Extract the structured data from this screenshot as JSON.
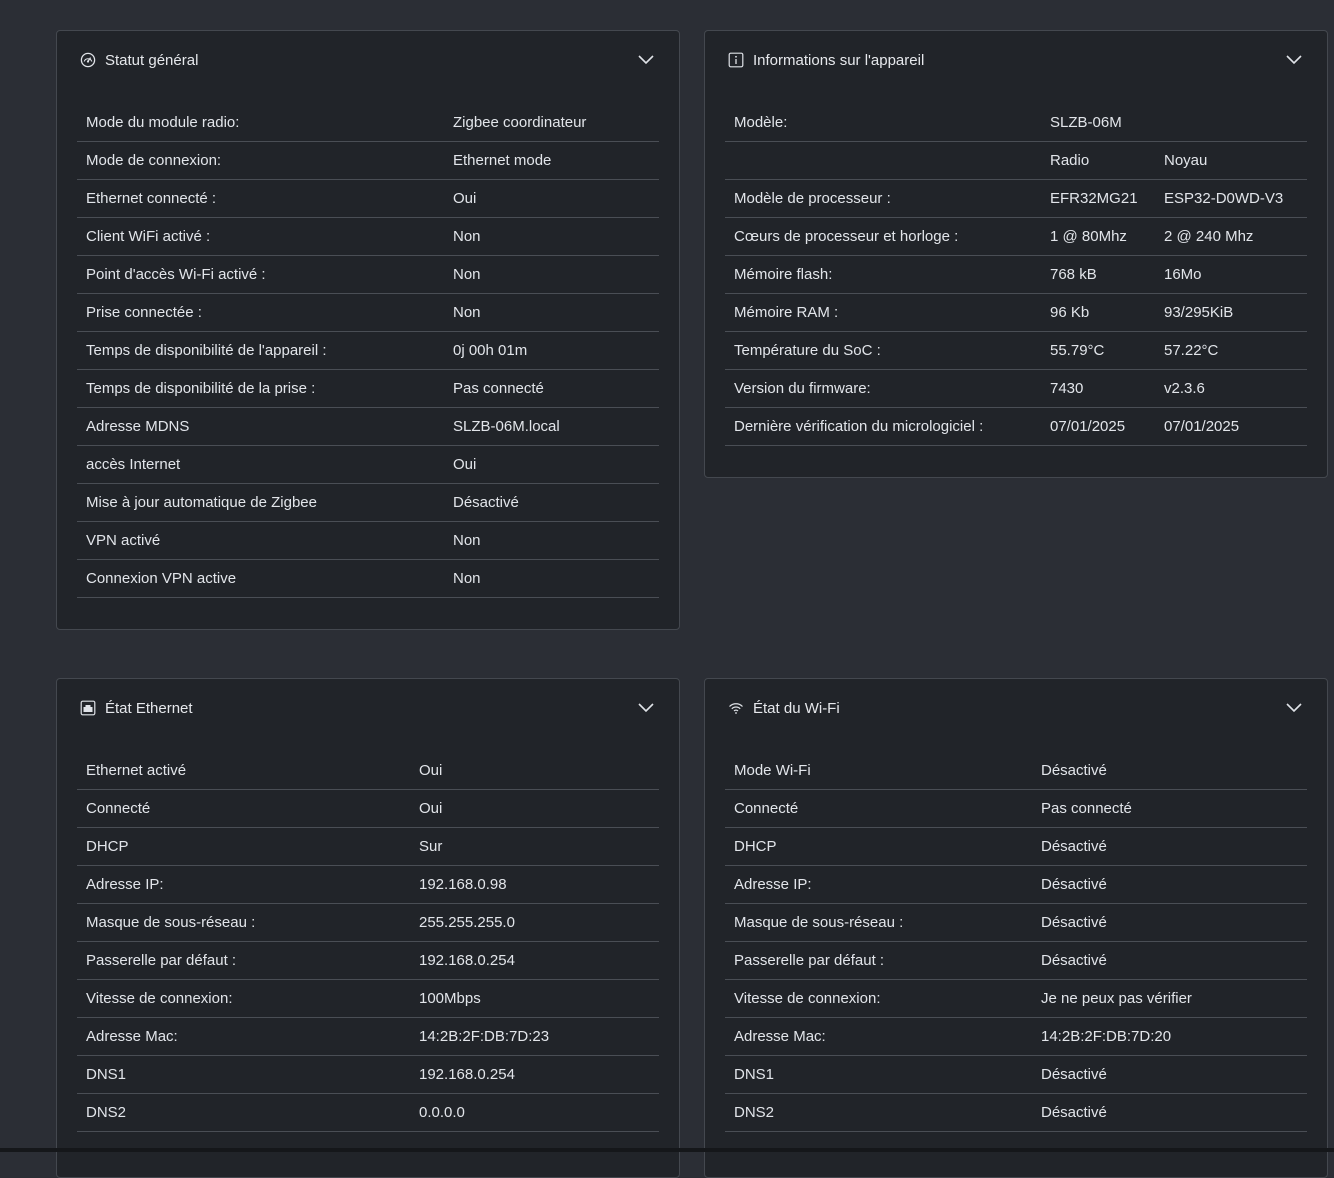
{
  "status": {
    "title": "Statut général",
    "rows": [
      {
        "label": "Mode du module radio:",
        "value": "Zigbee coordinateur"
      },
      {
        "label": "Mode de connexion:",
        "value": "Ethernet mode"
      },
      {
        "label": "Ethernet connecté :",
        "value": "Oui"
      },
      {
        "label": "Client WiFi activé :",
        "value": "Non"
      },
      {
        "label": "Point d'accès Wi-Fi activé :",
        "value": "Non"
      },
      {
        "label": "Prise connectée :",
        "value": "Non"
      },
      {
        "label": "Temps de disponibilité de l'appareil :",
        "value": "0j 00h 01m"
      },
      {
        "label": "Temps de disponibilité de la prise :",
        "value": "Pas connecté"
      },
      {
        "label": "Adresse MDNS",
        "value": "SLZB-06M.local"
      },
      {
        "label": "accès Internet",
        "value": "Oui"
      },
      {
        "label": "Mise à jour automatique de Zigbee",
        "value": "Désactivé"
      },
      {
        "label": "VPN activé",
        "value": "Non"
      },
      {
        "label": "Connexion VPN active",
        "value": "Non"
      }
    ]
  },
  "device": {
    "title": "Informations sur l'appareil",
    "model_label": "Modèle:",
    "model_value": "SLZB-06M",
    "col_radio": "Radio",
    "col_core": "Noyau",
    "rows": [
      {
        "label": "Modèle de processeur :",
        "radio": "EFR32MG21",
        "core": "ESP32-D0WD-V3"
      },
      {
        "label": "Cœurs de processeur et horloge :",
        "radio": "1 @ 80Mhz",
        "core": "2 @ 240 Mhz"
      },
      {
        "label": "Mémoire flash:",
        "radio": "768 kB",
        "core": "16Mo"
      },
      {
        "label": "Mémoire RAM :",
        "radio": "96 Kb",
        "core": "93/295KiB"
      },
      {
        "label": "Température du SoC :",
        "radio": "55.79°C",
        "core": "57.22°C"
      },
      {
        "label": "Version du firmware:",
        "radio": "7430",
        "core": "v2.3.6"
      },
      {
        "label": "Dernière vérification du micrologiciel :",
        "radio": "07/01/2025",
        "core": "07/01/2025"
      }
    ]
  },
  "ethernet": {
    "title": "État Ethernet",
    "rows": [
      {
        "label": "Ethernet activé",
        "value": "Oui"
      },
      {
        "label": "Connecté",
        "value": "Oui"
      },
      {
        "label": "DHCP",
        "value": "Sur"
      },
      {
        "label": "Adresse IP:",
        "value": "192.168.0.98"
      },
      {
        "label": "Masque de sous-réseau :",
        "value": "255.255.255.0"
      },
      {
        "label": "Passerelle par défaut :",
        "value": "192.168.0.254"
      },
      {
        "label": "Vitesse de connexion:",
        "value": "100Mbps"
      },
      {
        "label": "Adresse Mac:",
        "value": "14:2B:2F:DB:7D:23"
      },
      {
        "label": "DNS1",
        "value": "192.168.0.254"
      },
      {
        "label": "DNS2",
        "value": "0.0.0.0"
      }
    ]
  },
  "wifi": {
    "title": "État du Wi-Fi",
    "rows": [
      {
        "label": "Mode Wi-Fi",
        "value": "Désactivé"
      },
      {
        "label": "Connecté",
        "value": "Pas connecté"
      },
      {
        "label": "DHCP",
        "value": "Désactivé"
      },
      {
        "label": "Adresse IP:",
        "value": "Désactivé"
      },
      {
        "label": "Masque de sous-réseau :",
        "value": "Désactivé"
      },
      {
        "label": "Passerelle par défaut :",
        "value": "Désactivé"
      },
      {
        "label": "Vitesse de connexion:",
        "value": "Je ne peux pas vérifier"
      },
      {
        "label": "Adresse Mac:",
        "value": "14:2B:2F:DB:7D:20"
      },
      {
        "label": "DNS1",
        "value": "Désactivé"
      },
      {
        "label": "DNS2",
        "value": "Désactivé"
      }
    ]
  }
}
